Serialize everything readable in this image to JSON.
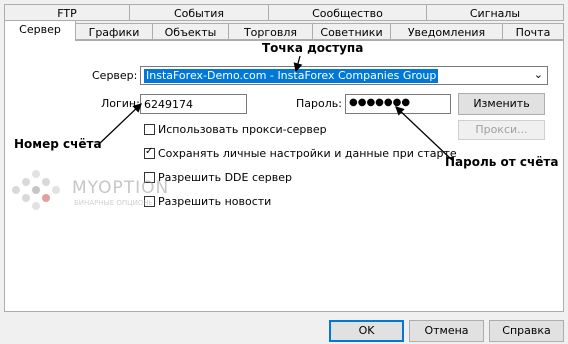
{
  "tabs_row1": [
    "FTP",
    "События",
    "Сообщество",
    "Сигналы"
  ],
  "tabs_row2": [
    "Сервер",
    "Графики",
    "Объекты",
    "Торговля",
    "Советники",
    "Уведомления",
    "Почта"
  ],
  "server": {
    "label": "Сервер:",
    "value": "InstaForex-Demo.com - InstaForex Companies Group"
  },
  "login": {
    "label": "Логин:",
    "value": "6249174"
  },
  "password": {
    "label": "Пароль:",
    "value": "●●●●●●●"
  },
  "change_button": "Изменить",
  "proxy_button": "Прокси...",
  "options": [
    {
      "label": "Использовать прокси-сервер",
      "checked": false
    },
    {
      "label": "Сохранять личные настройки и данные при старте",
      "checked": true
    },
    {
      "label": "Разрешить DDE сервер",
      "checked": false
    },
    {
      "label": "Разрешить новости",
      "checked": false
    }
  ],
  "annotations": {
    "access_point": "Точка доступа",
    "account_number": "Номер счёта",
    "account_password": "Пароль от счёта"
  },
  "watermark": {
    "brand": "MYOPTION",
    "tagline": "БИНАРНЫЕ ОПЦИОНЫ"
  },
  "footer": {
    "ok": "OK",
    "cancel": "Отмена",
    "help": "Справка"
  }
}
